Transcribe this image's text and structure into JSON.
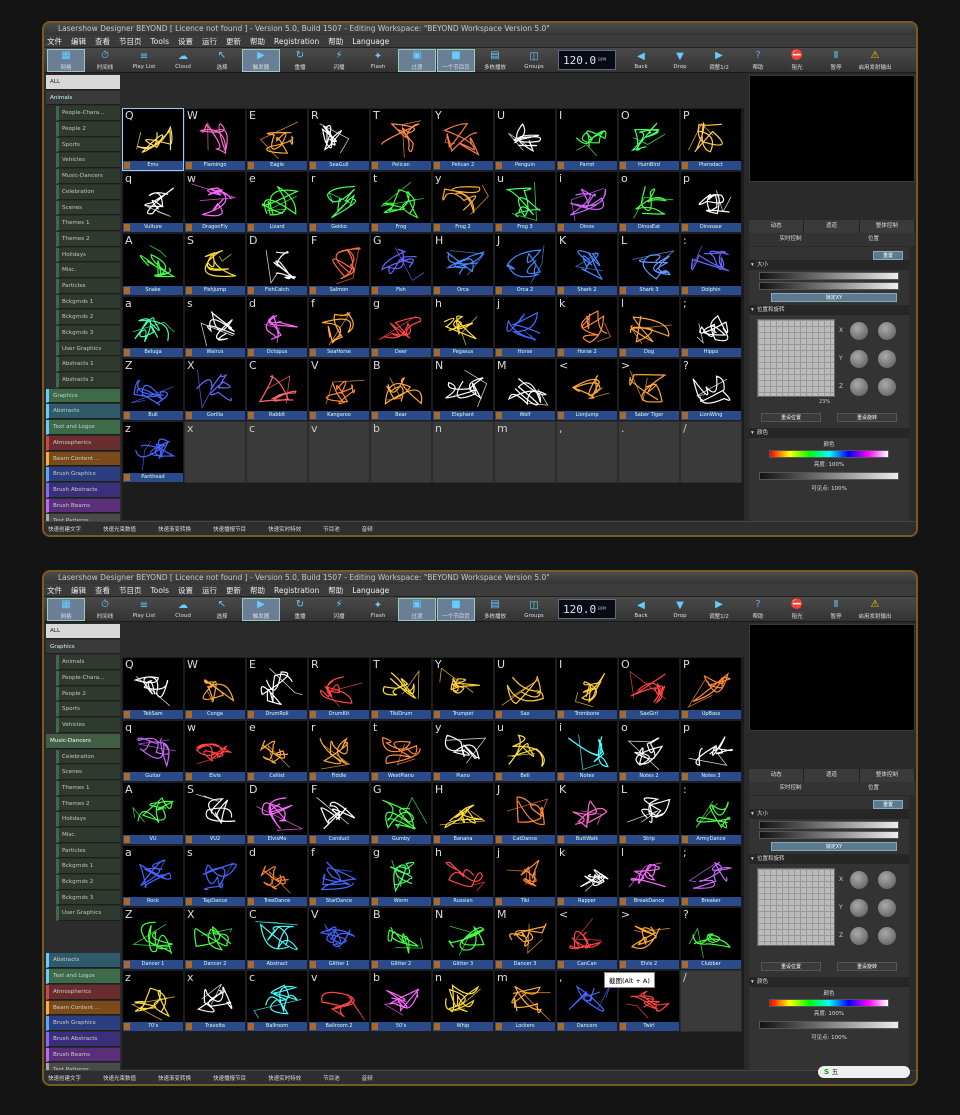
{
  "windows": [
    {
      "title": "Lasershow Designer BEYOND [ Licence not found ] - Version 5.0, Build 1507 - Editing Workspace: \"BEYOND Workspace Version 5.0\"",
      "menu": [
        "文件",
        "编辑",
        "查看",
        "节目页",
        "Tools",
        "设置",
        "运行",
        "更新",
        "帮助",
        "Registration",
        "帮助",
        "Language"
      ],
      "toolbar": [
        "网格",
        "时间线",
        "Play List",
        "Cloud",
        "选择",
        "触发器",
        "重播",
        "闪播",
        "Flash",
        "过渡",
        "一个节目页",
        "多栋播放",
        "Groups",
        "Back",
        "Drop",
        "调整1/2",
        "帮助",
        "阻光",
        "暂停",
        "启用发射输出"
      ],
      "bpm": "120.0",
      "bpm_unit": "BPM",
      "categories": [
        {
          "label": "ALL",
          "type": "all"
        },
        {
          "label": "Animals",
          "type": "main"
        },
        {
          "label": "People-Chara...",
          "type": "sub"
        },
        {
          "label": "People 2",
          "type": "sub"
        },
        {
          "label": "Sports",
          "type": "sub"
        },
        {
          "label": "Vehicles",
          "type": "sub"
        },
        {
          "label": "Music-Dancers",
          "type": "sub"
        },
        {
          "label": "Celebration",
          "type": "sub"
        },
        {
          "label": "Scenes",
          "type": "sub"
        },
        {
          "label": "Themes 1",
          "type": "sub"
        },
        {
          "label": "Themes 2",
          "type": "sub"
        },
        {
          "label": "Holidays",
          "type": "sub"
        },
        {
          "label": "Misc.",
          "type": "sub"
        },
        {
          "label": "Particles",
          "type": "sub"
        },
        {
          "label": "Bckgrnds 1",
          "type": "sub"
        },
        {
          "label": "Bckgrnds 2",
          "type": "sub"
        },
        {
          "label": "Bckgrnds 3",
          "type": "sub"
        },
        {
          "label": "User Graphics",
          "type": "sub"
        },
        {
          "label": "Abstracts 1",
          "type": "sub"
        },
        {
          "label": "Abstracts 2",
          "type": "sub"
        },
        {
          "label": "Graphics",
          "type": "c-green"
        },
        {
          "label": "Abstracts",
          "type": "c-teal"
        },
        {
          "label": "Text and Logos",
          "type": "c-green"
        },
        {
          "label": "Atmospherics",
          "type": "c-red"
        },
        {
          "label": "Beam Content ...",
          "type": "c-orange"
        },
        {
          "label": "Brush Graphics",
          "type": "c-blue"
        },
        {
          "label": "Brush Abstracts",
          "type": "c-indigo"
        },
        {
          "label": "Brush Beams",
          "type": "c-purple"
        },
        {
          "label": "Test Patterns",
          "type": "c-gray"
        }
      ],
      "cells": [
        {
          "key": "Q",
          "name": "Emu",
          "color": "#ffdd55"
        },
        {
          "key": "W",
          "name": "Flamingo",
          "color": "#ff66cc"
        },
        {
          "key": "E",
          "name": "Eagle",
          "color": "#ffaa33"
        },
        {
          "key": "R",
          "name": "SeaGull",
          "color": "#ffffff"
        },
        {
          "key": "T",
          "name": "Pelican",
          "color": "#ff8844"
        },
        {
          "key": "Y",
          "name": "Pelican 2",
          "color": "#ff7744"
        },
        {
          "key": "U",
          "name": "Penguin",
          "color": "#ffffff"
        },
        {
          "key": "I",
          "name": "Parrot",
          "color": "#44ff44"
        },
        {
          "key": "O",
          "name": "HumBird",
          "color": "#44ff66"
        },
        {
          "key": "P",
          "name": "Pterodact",
          "color": "#ffcc44"
        },
        {
          "key": "q",
          "name": "Vulture",
          "color": "#ffffff"
        },
        {
          "key": "w",
          "name": "DragonFly",
          "color": "#ff66ff"
        },
        {
          "key": "e",
          "name": "Lizard",
          "color": "#44ff44"
        },
        {
          "key": "r",
          "name": "Gekko",
          "color": "#44ff66"
        },
        {
          "key": "t",
          "name": "Frog",
          "color": "#44ff44"
        },
        {
          "key": "y",
          "name": "Frog 2",
          "color": "#ffaa33"
        },
        {
          "key": "u",
          "name": "Frog 3",
          "color": "#44ff66"
        },
        {
          "key": "i",
          "name": "Dinos",
          "color": "#cc66ff"
        },
        {
          "key": "o",
          "name": "DinosEat",
          "color": "#44ff44"
        },
        {
          "key": "p",
          "name": "Dinosaur",
          "color": "#ffffff"
        },
        {
          "key": "A",
          "name": "Snake",
          "color": "#44ff44"
        },
        {
          "key": "S",
          "name": "FishJump",
          "color": "#ffdd33"
        },
        {
          "key": "D",
          "name": "FishCatch",
          "color": "#ffffff"
        },
        {
          "key": "F",
          "name": "Salmon",
          "color": "#ff6644"
        },
        {
          "key": "G",
          "name": "Fish",
          "color": "#6666ff"
        },
        {
          "key": "H",
          "name": "Orca",
          "color": "#4488ff"
        },
        {
          "key": "J",
          "name": "Orca 2",
          "color": "#4488ff"
        },
        {
          "key": "K",
          "name": "Shark 2",
          "color": "#4488ff"
        },
        {
          "key": "L",
          "name": "Shark 3",
          "color": "#6699ff"
        },
        {
          "key": ":",
          "name": "Dolphin",
          "color": "#6666ff"
        },
        {
          "key": "a",
          "name": "Beluga",
          "color": "#44ffaa"
        },
        {
          "key": "s",
          "name": "Walrus",
          "color": "#ffffff"
        },
        {
          "key": "d",
          "name": "Octopus",
          "color": "#ff66ff"
        },
        {
          "key": "f",
          "name": "SeaHorse",
          "color": "#ffaa33"
        },
        {
          "key": "g",
          "name": "Deer",
          "color": "#ff4444"
        },
        {
          "key": "h",
          "name": "Pegasus",
          "color": "#ffdd33"
        },
        {
          "key": "j",
          "name": "Horse",
          "color": "#4466ff"
        },
        {
          "key": "k",
          "name": "Horse 2",
          "color": "#ff8833"
        },
        {
          "key": "l",
          "name": "Dog",
          "color": "#ffaa33"
        },
        {
          "key": ";",
          "name": "Hippo",
          "color": "#ffffff"
        },
        {
          "key": "Z",
          "name": "Bull",
          "color": "#4466ff"
        },
        {
          "key": "X",
          "name": "Gorilla",
          "color": "#6666ff"
        },
        {
          "key": "C",
          "name": "Rabbit",
          "color": "#ff6666"
        },
        {
          "key": "V",
          "name": "Kangaroo",
          "color": "#ff8833"
        },
        {
          "key": "B",
          "name": "Bear",
          "color": "#ffaa33"
        },
        {
          "key": "N",
          "name": "Elephant",
          "color": "#ffffff"
        },
        {
          "key": "M",
          "name": "Wolf",
          "color": "#ffffff"
        },
        {
          "key": "<",
          "name": "LionJump",
          "color": "#ffaa33"
        },
        {
          "key": ">",
          "name": "Saber Tiger",
          "color": "#ffaa33"
        },
        {
          "key": "?",
          "name": "LionWing",
          "color": "#ffffff"
        },
        {
          "key": "z",
          "name": "Panthead",
          "color": "#4466ff"
        },
        {
          "key": "x",
          "name": "",
          "color": ""
        },
        {
          "key": "c",
          "name": "",
          "color": ""
        },
        {
          "key": "v",
          "name": "",
          "color": ""
        },
        {
          "key": "b",
          "name": "",
          "color": ""
        },
        {
          "key": "n",
          "name": "",
          "color": ""
        },
        {
          "key": "m",
          "name": "",
          "color": ""
        },
        {
          "key": ",",
          "name": "",
          "color": ""
        },
        {
          "key": ".",
          "name": "",
          "color": ""
        },
        {
          "key": "/",
          "name": "",
          "color": ""
        }
      ],
      "selected_cell": 0,
      "prop_tabs": [
        "动态",
        "遗道",
        "整体控制"
      ],
      "prop_tabs2": [
        "实时控制",
        "位置"
      ],
      "reset_btn": "重置",
      "size_section": "大小",
      "lock_btn": "锁定XY",
      "pos_section": "位置和旋转",
      "axes": [
        "X",
        "Y",
        "Z"
      ],
      "pad_label": "23%",
      "reset_pos": "重设位置",
      "reset_rot": "重设旋转",
      "color_section": "颜色",
      "color_label": "颜色",
      "bright_label": "亮度: 100%",
      "visible_label": "可见点: 100%",
      "status": [
        "快速创建文字",
        "快速光束数值",
        "快速渐变转换",
        "快速播报节目",
        "快速实时特效",
        "节目池",
        "音频"
      ],
      "tooltip": "",
      "ime": ""
    },
    {
      "title": "Lasershow Designer BEYOND [ Licence not found ] - Version 5.0, Build 1507 - Editing Workspace: \"BEYOND Workspace Version 5.0\"",
      "menu": [
        "文件",
        "编辑",
        "查看",
        "节目页",
        "Tools",
        "设置",
        "运行",
        "更新",
        "帮助",
        "Registration",
        "帮助",
        "Language"
      ],
      "toolbar": [
        "网格",
        "时间线",
        "Play List",
        "Cloud",
        "选择",
        "触发器",
        "重播",
        "闪播",
        "Flash",
        "过渡",
        "一个节目页",
        "多栋播放",
        "Groups",
        "Back",
        "Drop",
        "调整1/2",
        "帮助",
        "阻光",
        "暂停",
        "启用发射输出"
      ],
      "bpm": "120.0",
      "bpm_unit": "BPM",
      "categories": [
        {
          "label": "ALL",
          "type": "all"
        },
        {
          "label": "Graphics",
          "type": "main"
        },
        {
          "label": "Animals",
          "type": "sub"
        },
        {
          "label": "People-Chara...",
          "type": "sub"
        },
        {
          "label": "People 2",
          "type": "sub"
        },
        {
          "label": "Sports",
          "type": "sub"
        },
        {
          "label": "Vehicles",
          "type": "sub"
        },
        {
          "label": "Music-Dancers",
          "type": "sel"
        },
        {
          "label": "Celebration",
          "type": "sub"
        },
        {
          "label": "Scenes",
          "type": "sub"
        },
        {
          "label": "Themes 1",
          "type": "sub"
        },
        {
          "label": "Themes 2",
          "type": "sub"
        },
        {
          "label": "Holidays",
          "type": "sub"
        },
        {
          "label": "Misc.",
          "type": "sub"
        },
        {
          "label": "Particles",
          "type": "sub"
        },
        {
          "label": "Bckgrnds 1",
          "type": "sub"
        },
        {
          "label": "Bckgrnds 2",
          "type": "sub"
        },
        {
          "label": "Bckgrnds 3",
          "type": "sub"
        },
        {
          "label": "User Graphics",
          "type": "sub"
        },
        {
          "label": "",
          "type": "blank"
        },
        {
          "label": "",
          "type": "blank"
        },
        {
          "label": "Abstracts",
          "type": "c-teal"
        },
        {
          "label": "Text and Logos",
          "type": "c-green"
        },
        {
          "label": "Atmospherics",
          "type": "c-red"
        },
        {
          "label": "Beam Content ...",
          "type": "c-orange"
        },
        {
          "label": "Brush Graphics",
          "type": "c-blue"
        },
        {
          "label": "Brush Abstracts",
          "type": "c-indigo"
        },
        {
          "label": "Brush Beams",
          "type": "c-purple"
        },
        {
          "label": "Test Patterns",
          "type": "c-gray"
        }
      ],
      "cells": [
        {
          "key": "Q",
          "name": "TekSam",
          "color": "#ffffff"
        },
        {
          "key": "W",
          "name": "Conga",
          "color": "#ffaa33"
        },
        {
          "key": "E",
          "name": "DrumRoll",
          "color": "#ffffff"
        },
        {
          "key": "R",
          "name": "DrumKit",
          "color": "#ff4444"
        },
        {
          "key": "T",
          "name": "TikiDrum",
          "color": "#ffdd33"
        },
        {
          "key": "Y",
          "name": "Trumpet",
          "color": "#ffcc33"
        },
        {
          "key": "U",
          "name": "Sax",
          "color": "#ffcc33"
        },
        {
          "key": "I",
          "name": "Trombone",
          "color": "#ffcc33"
        },
        {
          "key": "O",
          "name": "SaxGirl",
          "color": "#ff4444"
        },
        {
          "key": "P",
          "name": "UpBass",
          "color": "#ff8833"
        },
        {
          "key": "q",
          "name": "Guitar",
          "color": "#cc66ff"
        },
        {
          "key": "w",
          "name": "Elvis",
          "color": "#ff4444"
        },
        {
          "key": "e",
          "name": "Cellist",
          "color": "#ffaa33"
        },
        {
          "key": "r",
          "name": "Fiddle",
          "color": "#ffaa33"
        },
        {
          "key": "t",
          "name": "WestPiano",
          "color": "#ff8833"
        },
        {
          "key": "y",
          "name": "Piano",
          "color": "#ffffff"
        },
        {
          "key": "u",
          "name": "Bell",
          "color": "#ffdd33"
        },
        {
          "key": "i",
          "name": "Notes",
          "color": "#44ffff"
        },
        {
          "key": "o",
          "name": "Notes 2",
          "color": "#ffffff"
        },
        {
          "key": "p",
          "name": "Notes 3",
          "color": "#ffffff"
        },
        {
          "key": "A",
          "name": "VU",
          "color": "#44ff44"
        },
        {
          "key": "S",
          "name": "VU2",
          "color": "#ffffff"
        },
        {
          "key": "D",
          "name": "ElvisMo",
          "color": "#ff66ff"
        },
        {
          "key": "F",
          "name": "Conduct",
          "color": "#ffffff"
        },
        {
          "key": "G",
          "name": "Gumby",
          "color": "#44ff44"
        },
        {
          "key": "H",
          "name": "Banana",
          "color": "#ffdd33"
        },
        {
          "key": "J",
          "name": "CatDance",
          "color": "#ff8833"
        },
        {
          "key": "K",
          "name": "ButtWalk",
          "color": "#ff66cc"
        },
        {
          "key": "L",
          "name": "Strip",
          "color": "#ffffff"
        },
        {
          "key": ":",
          "name": "ArmyDance",
          "color": "#44ff44"
        },
        {
          "key": "a",
          "name": "Rock",
          "color": "#4466ff"
        },
        {
          "key": "s",
          "name": "TapDance",
          "color": "#4466ff"
        },
        {
          "key": "d",
          "name": "TreeDance",
          "color": "#ff8833"
        },
        {
          "key": "f",
          "name": "StarDance",
          "color": "#4466ff"
        },
        {
          "key": "g",
          "name": "Worm",
          "color": "#44ff66"
        },
        {
          "key": "h",
          "name": "Russian",
          "color": "#ff4444"
        },
        {
          "key": "j",
          "name": "Tiki",
          "color": "#ff8833"
        },
        {
          "key": "k",
          "name": "Rapper",
          "color": "#ffffff"
        },
        {
          "key": "l",
          "name": "BreakDance",
          "color": "#ff66ff"
        },
        {
          "key": ";",
          "name": "Breaker",
          "color": "#cc66ff"
        },
        {
          "key": "Z",
          "name": "Dancer 1",
          "color": "#44ff44"
        },
        {
          "key": "X",
          "name": "Dancer 2",
          "color": "#44ff44"
        },
        {
          "key": "C",
          "name": "Abstract",
          "color": "#44ffff"
        },
        {
          "key": "V",
          "name": "Glitter 1",
          "color": "#4466ff"
        },
        {
          "key": "B",
          "name": "Glitter 2",
          "color": "#44ff44"
        },
        {
          "key": "N",
          "name": "Glitter 3",
          "color": "#44ff44"
        },
        {
          "key": "M",
          "name": "Dancer 3",
          "color": "#ffaa33"
        },
        {
          "key": "<",
          "name": "CanCan",
          "color": "#ff4444"
        },
        {
          "key": ">",
          "name": "Elvis 2",
          "color": "#ffaa33"
        },
        {
          "key": "?",
          "name": "Clubber",
          "color": "#44ff44"
        },
        {
          "key": "z",
          "name": "70's",
          "color": "#ffdd33"
        },
        {
          "key": "x",
          "name": "Travolta",
          "color": "#ffffff"
        },
        {
          "key": "c",
          "name": "Ballroom",
          "color": "#44ffff"
        },
        {
          "key": "v",
          "name": "Ballroom 2",
          "color": "#ff4444"
        },
        {
          "key": "b",
          "name": "50's",
          "color": "#ff66ff"
        },
        {
          "key": "n",
          "name": "Whip",
          "color": "#ffdd33"
        },
        {
          "key": "m",
          "name": "Lockers",
          "color": "#ffaa33"
        },
        {
          "key": ",",
          "name": "Dancers",
          "color": "#4466ff"
        },
        {
          "key": ".",
          "name": "Twirl",
          "color": "#ff4444"
        },
        {
          "key": "/",
          "name": "",
          "color": ""
        }
      ],
      "selected_cell": -1,
      "prop_tabs": [
        "动态",
        "遗道",
        "整体控制"
      ],
      "prop_tabs2": [
        "实时控制",
        "位置"
      ],
      "reset_btn": "重置",
      "size_section": "大小",
      "lock_btn": "锁定XY",
      "pos_section": "位置和旋转",
      "axes": [
        "X",
        "Y",
        "Z"
      ],
      "pad_label": "",
      "reset_pos": "重设位置",
      "reset_rot": "重设旋转",
      "color_section": "颜色",
      "color_label": "颜色",
      "bright_label": "亮度: 100%",
      "visible_label": "可见点: 100%",
      "status": [
        "快速创建文字",
        "快速光束数值",
        "快速渐变转换",
        "快速播报节目",
        "快速实时特效",
        "节目池",
        "音频"
      ],
      "tooltip": "截图(Alt + A)",
      "ime": "五"
    }
  ],
  "colors": {
    "window_border": "#7a5a1e",
    "caption": "#2a4a8a",
    "preview_bg": "#000000"
  }
}
